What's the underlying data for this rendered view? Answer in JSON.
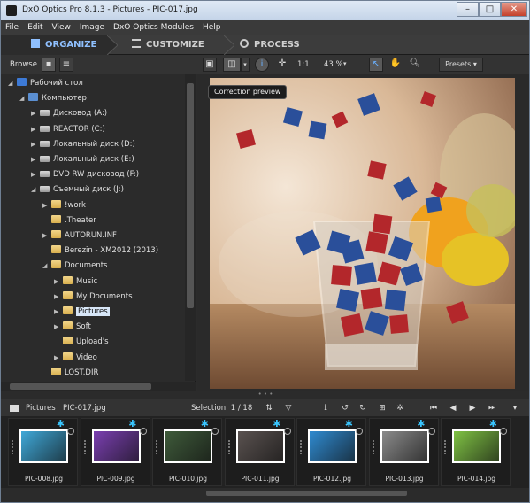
{
  "window": {
    "title": "DxO Optics Pro 8.1.3 - Pictures - PIC-017.jpg"
  },
  "menu": [
    "File",
    "Edit",
    "View",
    "Image",
    "DxO Optics Modules",
    "Help"
  ],
  "tabs": [
    {
      "label": "ORGANIZE",
      "active": true
    },
    {
      "label": "CUSTOMIZE",
      "active": false
    },
    {
      "label": "PROCESS",
      "active": false
    }
  ],
  "toolbar": {
    "browse_label": "Browse",
    "zoom_ratio": "1:1",
    "zoom_percent": "43 %",
    "presets_label": "Presets"
  },
  "tooltip": "Correction preview",
  "tree": [
    {
      "label": "Рабочий стол",
      "depth": 0,
      "expanded": true,
      "icon": "desktop-icon"
    },
    {
      "label": "Компьютер",
      "depth": 1,
      "expanded": true,
      "icon": "computer-icon"
    },
    {
      "label": "Дисковод (A:)",
      "depth": 2,
      "expanded": false,
      "icon": "drive-icon"
    },
    {
      "label": "REACTOR (C:)",
      "depth": 2,
      "expanded": false,
      "icon": "drive-icon"
    },
    {
      "label": "Локальный диск (D:)",
      "depth": 2,
      "expanded": false,
      "icon": "drive-icon"
    },
    {
      "label": "Локальный диск (E:)",
      "depth": 2,
      "expanded": false,
      "icon": "drive-icon"
    },
    {
      "label": "DVD RW дисковод (F:)",
      "depth": 2,
      "expanded": false,
      "icon": "drive-icon"
    },
    {
      "label": "Съемный диск (J:)",
      "depth": 2,
      "expanded": true,
      "icon": "drive-icon"
    },
    {
      "label": "!work",
      "depth": 3,
      "expanded": false,
      "icon": "folder-icon"
    },
    {
      "label": ".Theater",
      "depth": 3,
      "expanded": null,
      "icon": "folder-icon"
    },
    {
      "label": "AUTORUN.INF",
      "depth": 3,
      "expanded": false,
      "icon": "folder-icon"
    },
    {
      "label": "Berezin - XM2012 (2013)",
      "depth": 3,
      "expanded": null,
      "icon": "folder-icon"
    },
    {
      "label": "Documents",
      "depth": 3,
      "expanded": true,
      "icon": "folder-icon"
    },
    {
      "label": "Music",
      "depth": 4,
      "expanded": false,
      "icon": "folder-icon"
    },
    {
      "label": "My Documents",
      "depth": 4,
      "expanded": false,
      "icon": "folder-icon"
    },
    {
      "label": "Pictures",
      "depth": 4,
      "expanded": false,
      "icon": "folder-icon",
      "selected": true
    },
    {
      "label": "Soft",
      "depth": 4,
      "expanded": false,
      "icon": "folder-icon"
    },
    {
      "label": "Upload's",
      "depth": 4,
      "expanded": null,
      "icon": "folder-icon"
    },
    {
      "label": "Video",
      "depth": 4,
      "expanded": false,
      "icon": "folder-icon"
    },
    {
      "label": "LOST.DIR",
      "depth": 3,
      "expanded": null,
      "icon": "folder-icon"
    }
  ],
  "strip": {
    "folder": "Pictures",
    "file": "PIC-017.jpg",
    "selection": "Selection: 1 / 18"
  },
  "thumbs": [
    {
      "name": "PIC-008.jpg",
      "color": "#3fa8d8"
    },
    {
      "name": "PIC-009.jpg",
      "color": "#7a3fb0"
    },
    {
      "name": "PIC-010.jpg",
      "color": "#3e5a3a"
    },
    {
      "name": "PIC-011.jpg",
      "color": "#5a5250"
    },
    {
      "name": "PIC-012.jpg",
      "color": "#2f8ad0"
    },
    {
      "name": "PIC-013.jpg",
      "color": "#8a8a8a"
    },
    {
      "name": "PIC-014.jpg",
      "color": "#7fc244"
    }
  ]
}
